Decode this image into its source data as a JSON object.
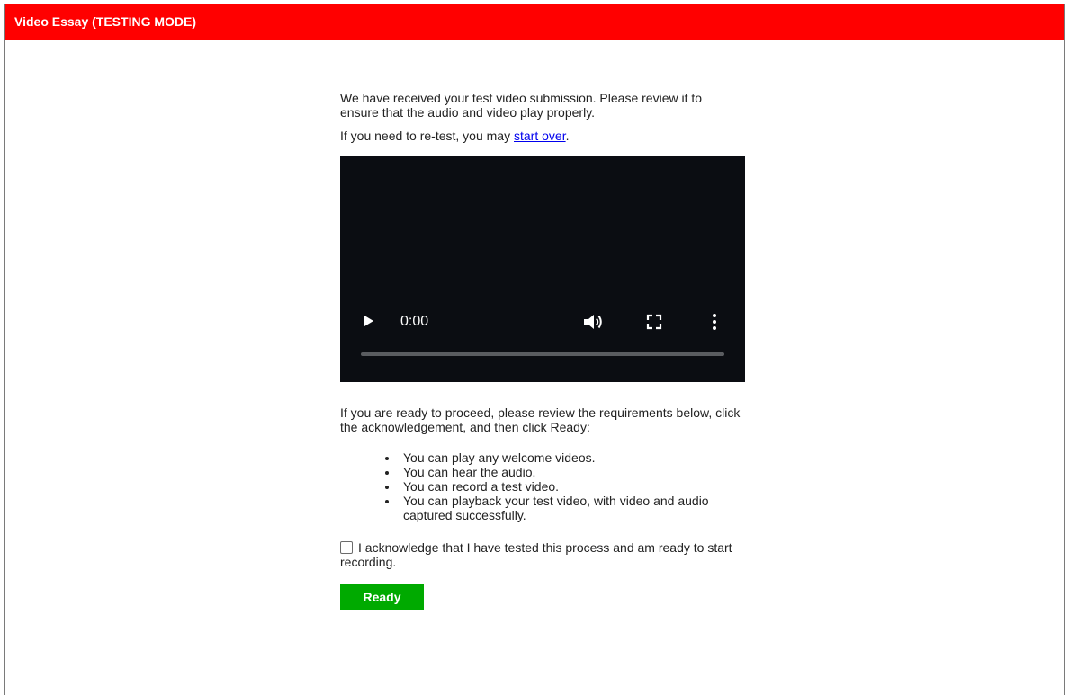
{
  "header": {
    "title": "Video Essay (TESTING MODE)",
    "color": "#ff0000"
  },
  "intro": {
    "received_text": "We have received your test video submission. Please review it to ensure that the audio and video play properly.",
    "retest_prefix": "If you need to re-test, you may ",
    "start_over_link": "start over",
    "retest_suffix": "."
  },
  "video": {
    "time": "0:00",
    "progress": 0,
    "icons": [
      "play-icon",
      "volume-icon",
      "fullscreen-icon",
      "more-options-icon"
    ]
  },
  "instructions": {
    "proceed_text": "If you are ready to proceed, please review the requirements below, click the acknowledgement, and then click Ready:",
    "requirements": [
      "You can play any welcome videos.",
      "You can hear the audio.",
      "You can record a test video.",
      "You can playback your test video, with video and audio captured successfully."
    ]
  },
  "acknowledgement": {
    "checked": false,
    "label": "I acknowledge that I have tested this process and am ready to start recording."
  },
  "ready_button": {
    "label": "Ready",
    "color": "#00aa00"
  }
}
